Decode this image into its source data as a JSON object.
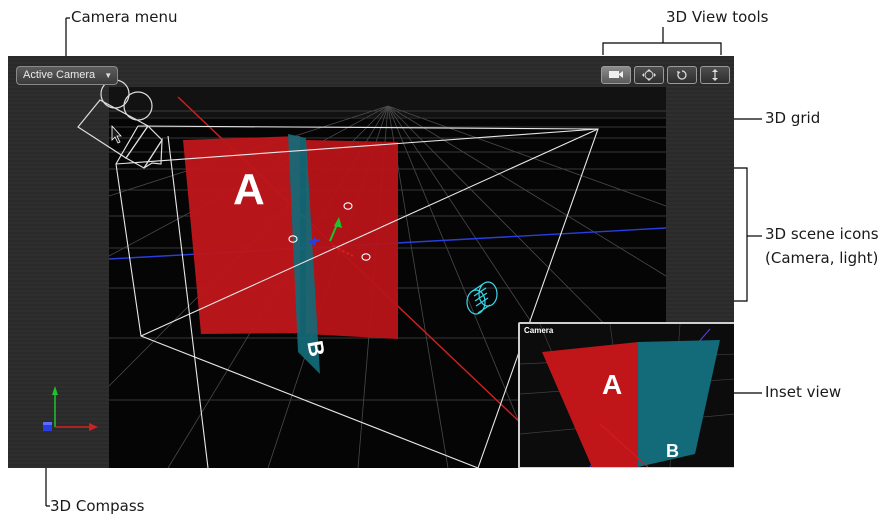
{
  "callouts": {
    "camera_menu": "Camera menu",
    "view_tools": "3D View tools",
    "grid": "3D grid",
    "scene_icons_line1": "3D scene icons",
    "scene_icons_line2": "(Camera, light)",
    "inset_view": "Inset view",
    "compass": "3D Compass"
  },
  "viewer": {
    "camera_menu_value": "Active Camera",
    "tools": [
      {
        "icon": "camera-icon",
        "selected": true
      },
      {
        "icon": "pan-icon",
        "selected": false
      },
      {
        "icon": "orbit-icon",
        "selected": false
      },
      {
        "icon": "dolly-icon",
        "selected": false
      }
    ],
    "scene": {
      "layer_a_label": "A",
      "layer_b_label": "B",
      "layer_a_color": "#c0161a",
      "layer_b_color": "#136a78",
      "axis_x_color": "#d22020",
      "axis_y_color": "#1ec22e",
      "axis_z_color": "#2a3ee0",
      "light_icon_color": "#38d8e8"
    },
    "inset": {
      "title": "Camera",
      "layer_a_label": "A",
      "layer_b_label": "B"
    }
  },
  "colors": {
    "viewer_bg": "#2b2b2b",
    "scene_bg": "#050505",
    "callout_line": "#000000"
  }
}
